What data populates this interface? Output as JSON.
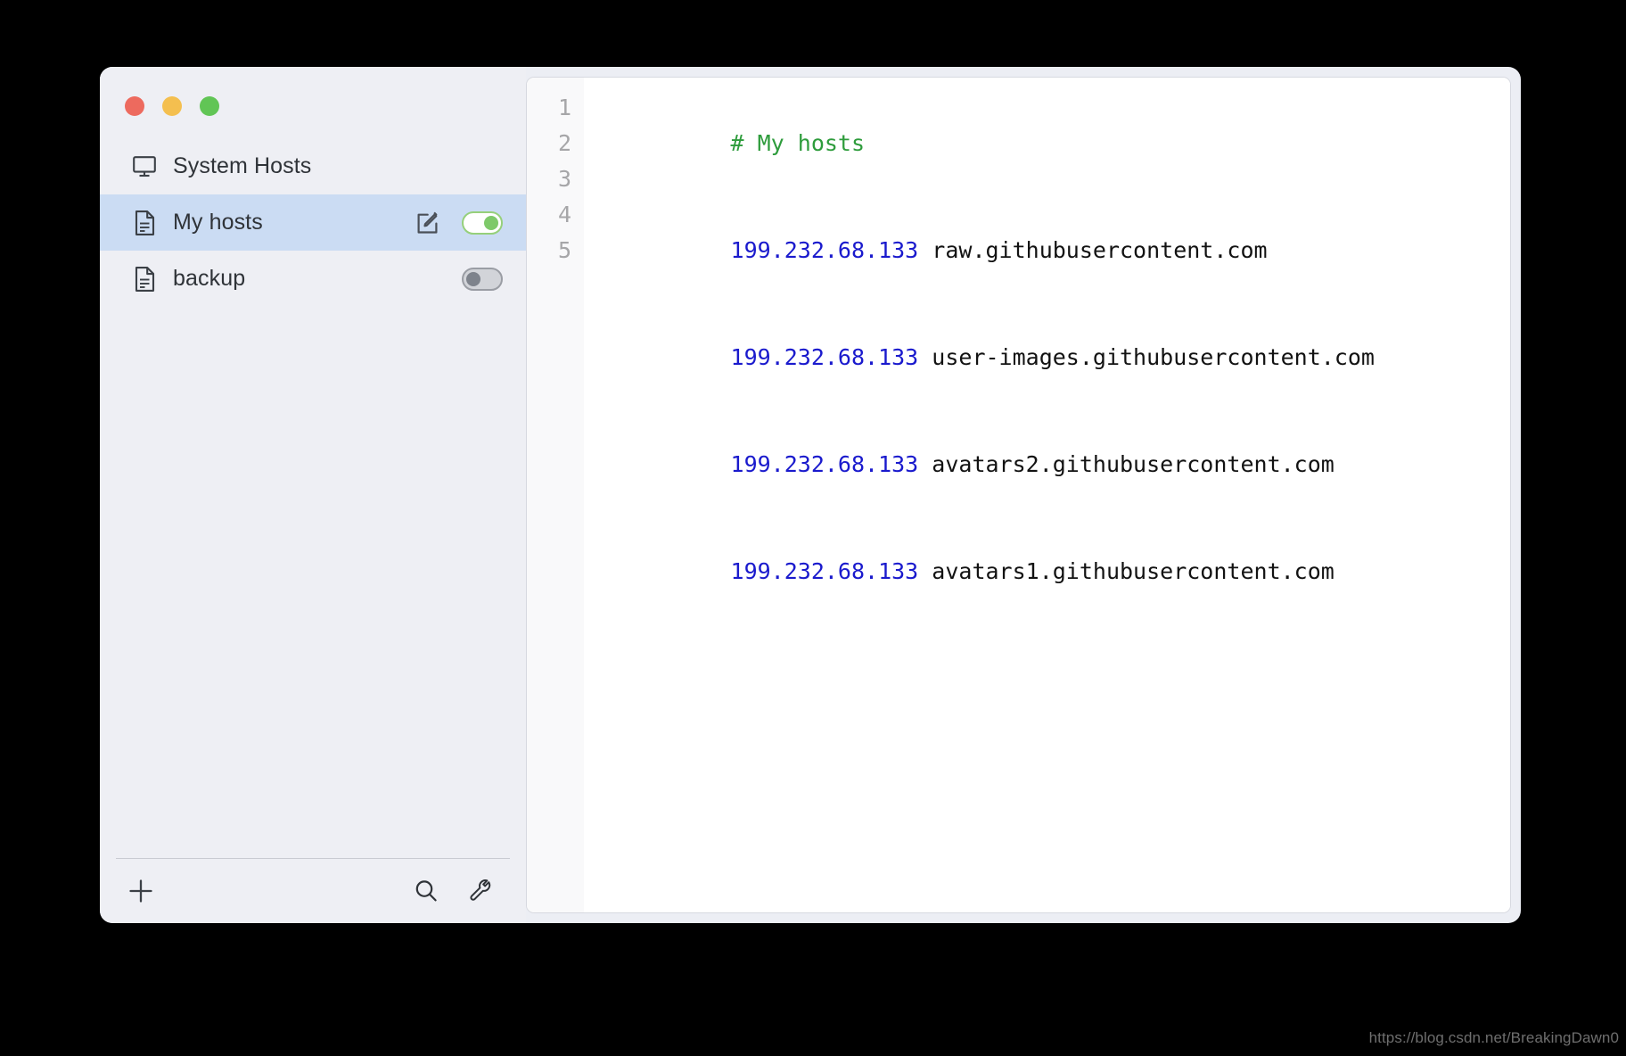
{
  "window": {
    "traffic_lights": [
      {
        "name": "close",
        "color": "#ed6a5e",
        "label": "Close"
      },
      {
        "name": "minimize",
        "color": "#f4bf4f",
        "label": "Minimize"
      },
      {
        "name": "zoom",
        "color": "#61c555",
        "label": "Zoom"
      }
    ]
  },
  "sidebar": {
    "items": [
      {
        "label": "System Hosts",
        "icon": "monitor-icon",
        "selected": false,
        "has_edit": false,
        "has_toggle": false,
        "toggle_state": ""
      },
      {
        "label": "My hosts",
        "icon": "document-icon",
        "selected": true,
        "has_edit": true,
        "edit_icon": "edit-pencil-icon",
        "has_toggle": true,
        "toggle_state": "on"
      },
      {
        "label": "backup",
        "icon": "document-icon",
        "selected": false,
        "has_edit": false,
        "has_toggle": true,
        "toggle_state": "off"
      }
    ],
    "toolbar": {
      "add_label": "+",
      "add_icon": "plus-icon",
      "search_icon": "search-icon",
      "tools_icon": "wrench-icon"
    }
  },
  "editor": {
    "gutter_numbers": [
      "1",
      "2",
      "3",
      "4",
      "5"
    ],
    "lines": [
      {
        "type": "comment",
        "comment": "# My hosts",
        "ip": "",
        "host": ""
      },
      {
        "type": "entry",
        "comment": "",
        "ip": "199.232.68.133",
        "host": " raw.githubusercontent.com"
      },
      {
        "type": "entry",
        "comment": "",
        "ip": "199.232.68.133",
        "host": " user-images.githubusercontent.com"
      },
      {
        "type": "entry",
        "comment": "",
        "ip": "199.232.68.133",
        "host": " avatars2.githubusercontent.com"
      },
      {
        "type": "entry",
        "comment": "",
        "ip": "199.232.68.133",
        "host": " avatars1.githubusercontent.com"
      }
    ]
  },
  "watermark": {
    "text": "https://blog.csdn.net/BreakingDawn0"
  },
  "colors": {
    "selected_row": "#cbdcf3",
    "sidebar_bg": "#eeeff4",
    "toggle_on": "#7ec96a",
    "toggle_off": "#7e838c",
    "comment": "#2e9c3c",
    "ip": "#1a1acd",
    "line_number": "#a6a6a8"
  }
}
